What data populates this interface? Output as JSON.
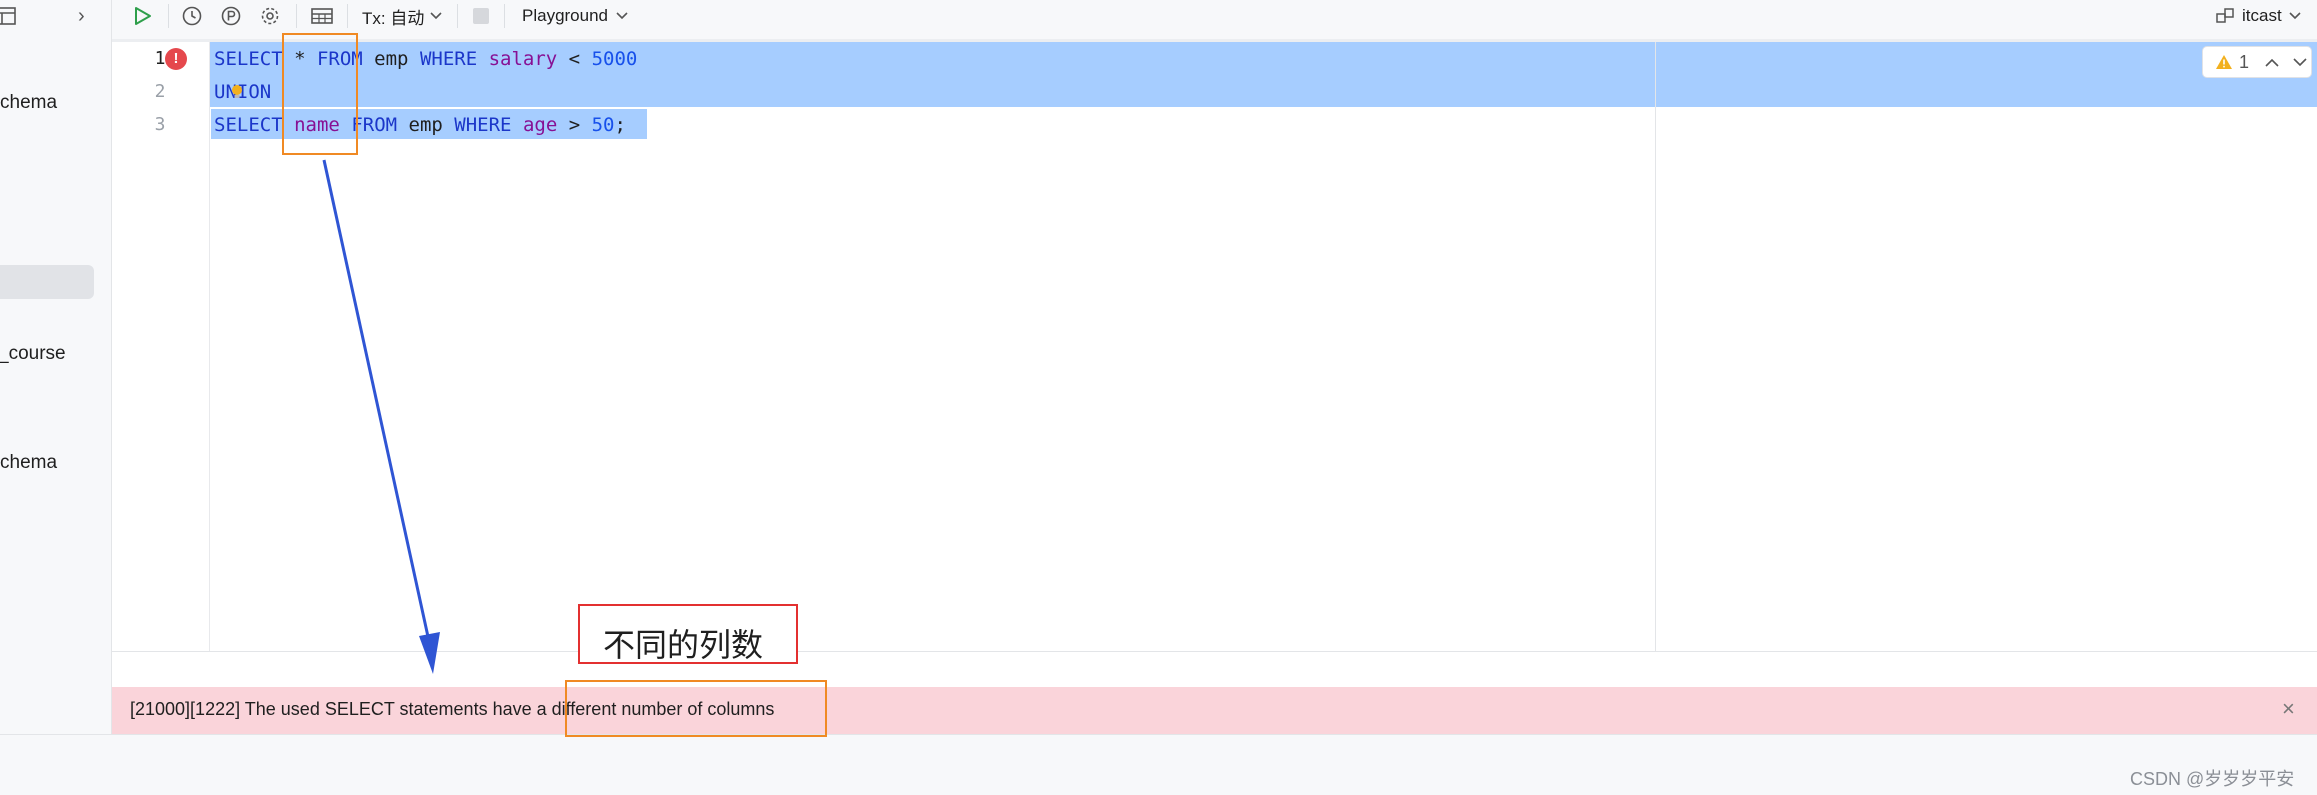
{
  "sidebar": {
    "items": [
      {
        "label": "chema"
      },
      {
        "label": "_course"
      },
      {
        "label": "chema"
      }
    ]
  },
  "toolbar": {
    "tx_label": "Tx: 自动",
    "playground_label": "Playground",
    "datasource_label": "itcast"
  },
  "editor": {
    "line_numbers": [
      "1",
      "2",
      "3"
    ],
    "lines": [
      [
        {
          "t": "SELECT",
          "c": "kw"
        },
        {
          "t": " * ",
          "c": ""
        },
        {
          "t": "FROM",
          "c": "kw"
        },
        {
          "t": " emp ",
          "c": ""
        },
        {
          "t": "WHERE",
          "c": "kw"
        },
        {
          "t": " ",
          "c": ""
        },
        {
          "t": "salary",
          "c": "id"
        },
        {
          "t": " < ",
          "c": ""
        },
        {
          "t": "5000",
          "c": "num"
        }
      ],
      [
        {
          "t": "UNION",
          "c": "kw"
        }
      ],
      [
        {
          "t": "SELECT",
          "c": "kw"
        },
        {
          "t": " ",
          "c": ""
        },
        {
          "t": "name",
          "c": "id"
        },
        {
          "t": " ",
          "c": ""
        },
        {
          "t": "FROM",
          "c": "kw"
        },
        {
          "t": " emp ",
          "c": ""
        },
        {
          "t": "WHERE",
          "c": "kw"
        },
        {
          "t": " ",
          "c": ""
        },
        {
          "t": "age",
          "c": "id"
        },
        {
          "t": " > ",
          "c": ""
        },
        {
          "t": "50",
          "c": "num"
        },
        {
          "t": ";",
          "c": ""
        }
      ]
    ],
    "error_glyph": "!",
    "inspection_count": "1"
  },
  "error_bar": {
    "message": "[21000][1222] The used SELECT statements have a different number of columns",
    "close_glyph": "×"
  },
  "annotation": {
    "label": "不同的列数"
  },
  "watermark": "CSDN @岁岁岁平安",
  "colors": {
    "keyword": "#1b36c9",
    "identifier": "#871094",
    "number": "#1750eb",
    "selection": "#a6cdff",
    "error_bar": "#fad4da",
    "annotation_orange": "#f08a24",
    "annotation_red": "#e33030",
    "arrow_blue": "#2f55d4"
  }
}
